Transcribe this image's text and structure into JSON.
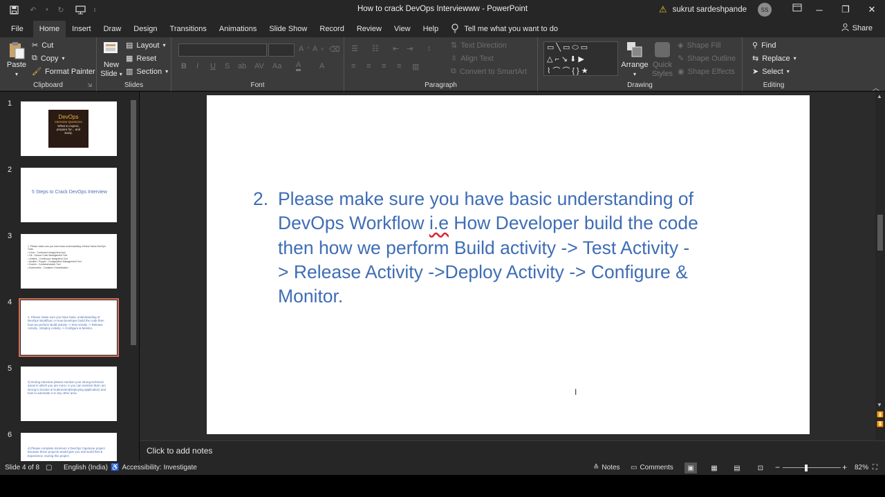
{
  "window": {
    "title": "How to crack DevOps Interviewww  -  PowerPoint",
    "user_name": "sukrut sardeshpande",
    "avatar_initials": "SS"
  },
  "tabs": [
    "File",
    "Home",
    "Insert",
    "Draw",
    "Design",
    "Transitions",
    "Animations",
    "Slide Show",
    "Record",
    "Review",
    "View",
    "Help"
  ],
  "active_tab": "Home",
  "tell_me": "Tell me what you want to do",
  "share_label": "Share",
  "ribbon": {
    "clipboard": {
      "paste": "Paste",
      "cut": "Cut",
      "copy": "Copy",
      "format_painter": "Format Painter",
      "label": "Clipboard"
    },
    "slides": {
      "new_slide_line1": "New",
      "new_slide_line2": "Slide",
      "layout": "Layout",
      "reset": "Reset",
      "section": "Section",
      "label": "Slides"
    },
    "font": {
      "label": "Font",
      "bold": "B",
      "italic": "I",
      "underline": "U",
      "strike": "S",
      "shadow": "ab",
      "spacing": "AV",
      "case": "Aa"
    },
    "paragraph": {
      "label": "Paragraph",
      "text_direction": "Text Direction",
      "align_text": "Align Text",
      "smartart": "Convert to SmartArt"
    },
    "drawing": {
      "label": "Drawing",
      "arrange": "Arrange",
      "quick_styles_line1": "Quick",
      "quick_styles_line2": "Styles",
      "shape_fill": "Shape Fill",
      "shape_outline": "Shape Outline",
      "shape_effects": "Shape Effects"
    },
    "editing": {
      "label": "Editing",
      "find": "Find",
      "replace": "Replace",
      "select": "Select"
    }
  },
  "thumbnails": [
    {
      "num": "1",
      "title": "DevOps",
      "subtitle": "Interview Questions",
      "body": "What to expect, prepare for... and study."
    },
    {
      "num": "2",
      "text": "5 Steps to Crack DevOps Interview"
    },
    {
      "num": "3",
      "text": "1.  Please make sure you have basic understanding of these below DevOps Tools\n•  Linux - Command Usage(Very low)\n•  Git - Source Code Management Tool\n•  Jenkins - Continuous Integration Tool\n•  Ansible / Puppet - Configuration Management Tool\n•  Docker - Containerization Tool\n•  Kubernetes - Container Orchestration"
    },
    {
      "num": "4",
      "text": "2.  Please make sure you have basic understanding of DevOps Workflow i.e How Developer build the code then  how we perform Build activity -> Test Activity -> Release Activity ->Deploy Activity -> Configure & Monitor."
    },
    {
      "num": "5",
      "text": "3) During Interview please mention your strong technical areas in which you are more i.e you can mention that I am strong in Docker & Kubernetes(Deploying application) and how to automate it or any other area."
    },
    {
      "num": "6",
      "text": "4) Please complete minimum 4 DevOps Capstone project because these projects would give you real world feel & Experience. During this project"
    }
  ],
  "slide": {
    "number_label": "2.",
    "body": "Please make sure you have basic understanding of\nDevOps Workflow i.e How Developer build the code\nthen  how we perform Build activity -> Test Activity -\n> Release Activity ->Deploy Activity -> Configure &\nMonitor."
  },
  "notes_placeholder": "Click to add notes",
  "status": {
    "slide_of": "Slide 4 of 8",
    "language": "English (India)",
    "accessibility": "Accessibility: Investigate",
    "notes": "Notes",
    "comments": "Comments",
    "zoom": "82%",
    "zoom_level_percent": 82
  }
}
